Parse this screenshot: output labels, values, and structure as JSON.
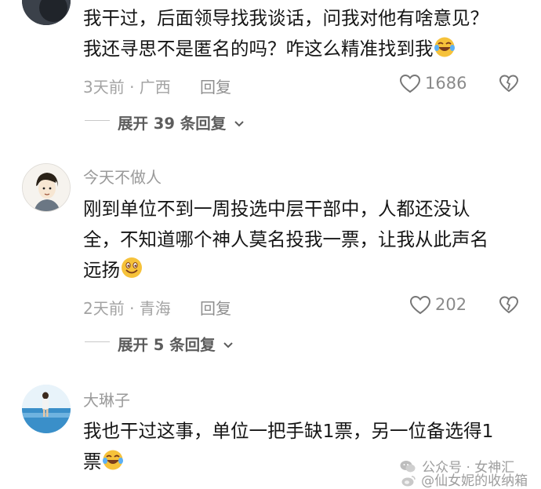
{
  "comments": [
    {
      "author": "",
      "lines": [
        "我干过，后面领导找我谈话，问我对他有啥意见？",
        "我还寻思不是匿名的吗？咋这么精准找到我"
      ],
      "emoji": "laugh-cry",
      "time_location": "3天前 · 广西",
      "reply_label": "回复",
      "likes": "1686",
      "expand_label": "展开 39 条回复"
    },
    {
      "author": "今天不做人",
      "lines": [
        "刚到单位不到一周投选中层干部中，人都还没认",
        "全，不知道哪个神人莫名投我一票，让我从此声名",
        "远扬"
      ],
      "emoji": "smile",
      "time_location": "2天前 · 青海",
      "reply_label": "回复",
      "likes": "202",
      "expand_label": "展开 5 条回复"
    },
    {
      "author": "大琳子",
      "lines": [
        "我也干过这事，单位一把手缺1票，另一位备选得1",
        "票"
      ],
      "emoji": "laugh-cry"
    }
  ],
  "watermarks": {
    "official": "公众号 · 女神汇",
    "weibo": "@仙女妮的收纳箱"
  },
  "colors": {
    "text": "#161616",
    "muted": "#9a9a9a",
    "emoji": "#f6c23a"
  }
}
